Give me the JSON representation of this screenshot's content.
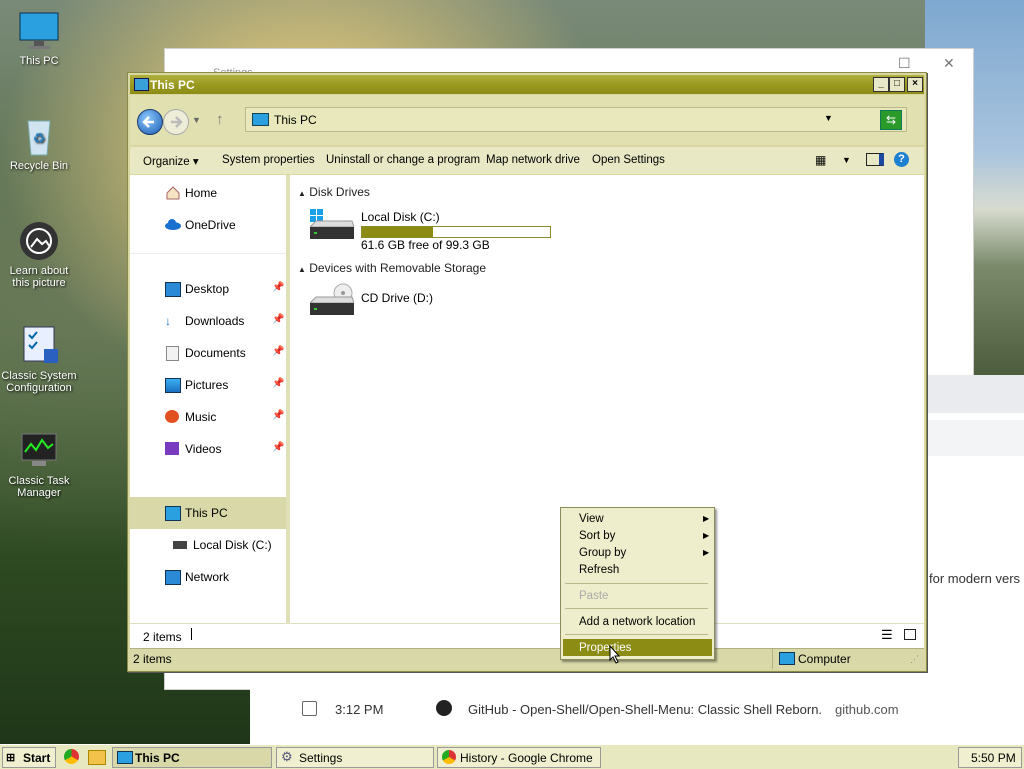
{
  "desktop": {
    "icons": [
      {
        "label": "This PC"
      },
      {
        "label": "Recycle Bin"
      },
      {
        "label": "Learn about this picture"
      },
      {
        "label": "Classic System Configuration"
      },
      {
        "label": "Classic Task Manager"
      }
    ]
  },
  "background": {
    "settings_title": "Settings",
    "history_row": {
      "time": "3:12 PM",
      "title": "GitHub - Open-Shell/Open-Shell-Menu: Classic Shell Reborn.",
      "domain": "github.com"
    },
    "partial_text": "for modern vers"
  },
  "explorer": {
    "title": "This PC",
    "address": "This PC",
    "commands": [
      "Organize",
      "System properties",
      "Uninstall or change a program",
      "Map network drive",
      "Open Settings"
    ],
    "nav": {
      "home": "Home",
      "onedrive": "OneDrive",
      "desktop": "Desktop",
      "downloads": "Downloads",
      "documents": "Documents",
      "pictures": "Pictures",
      "music": "Music",
      "videos": "Videos",
      "this_pc": "This PC",
      "local_disk": "Local Disk (C:)",
      "network": "Network"
    },
    "groups": {
      "disk_drives": "Disk Drives",
      "removable": "Devices with Removable Storage"
    },
    "drives": {
      "c_name": "Local Disk (C:)",
      "c_space": "61.6 GB free of 99.3 GB",
      "c_used_fraction": 0.38,
      "d_name": "CD Drive (D:)"
    },
    "status_items": "2 items",
    "status_bar_items": "2 items",
    "status_computer": "Computer"
  },
  "context_menu": {
    "view": "View",
    "sort_by": "Sort by",
    "group_by": "Group by",
    "refresh": "Refresh",
    "paste": "Paste",
    "add_network": "Add a network location",
    "properties": "Properties"
  },
  "taskbar": {
    "start": "Start",
    "items": [
      "This PC",
      "Settings",
      "History - Google Chrome"
    ],
    "clock": "5:50 PM"
  }
}
